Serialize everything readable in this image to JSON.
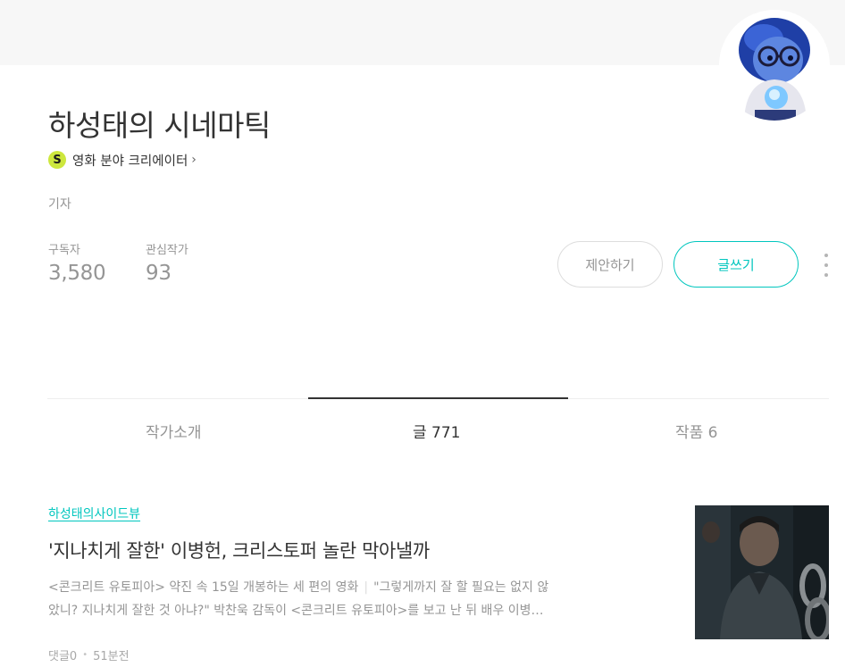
{
  "profile": {
    "blog_title": "하성태의 시네마틱",
    "creator_badge": "S",
    "creator_label": "영화 분야 크리에이터",
    "creator_chevron": "›",
    "job": "기자",
    "stats": [
      {
        "label": "구독자",
        "value": "3,580"
      },
      {
        "label": "관심작가",
        "value": "93"
      }
    ],
    "avatar_icon": "sadness-character-avatar"
  },
  "actions": {
    "suggest_label": "제안하기",
    "write_label": "글쓰기",
    "more_icon": "vertical-ellipsis-icon"
  },
  "tabs": [
    {
      "label": "작가소개",
      "active": false
    },
    {
      "label": "글 771",
      "active": true
    },
    {
      "label": "작품 6",
      "active": false
    }
  ],
  "article": {
    "magazine": "하성태의사이드뷰",
    "title": "'지나치게 잘한' 이병헌, 크리스토퍼 놀란 막아낼까",
    "excerpt_subtitle": "<콘크리트 유토피아> 약진 속 15일 개봉하는 세 편의 영화",
    "excerpt_line1_rest": "\"그렇게까지 잘 할 필요는 없지 않",
    "excerpt_line2": "았니? 지나치게 잘한 것 아냐?\" 박찬욱 감독이 <콘크리트 유토피아>를 보고 난 뒤 배우 이병…",
    "comments": "댓글0",
    "time": "51분전"
  },
  "colors": {
    "accent": "#00c6be",
    "badge": "#cde73d",
    "muted_text": "#959595",
    "main_text": "#333333"
  }
}
